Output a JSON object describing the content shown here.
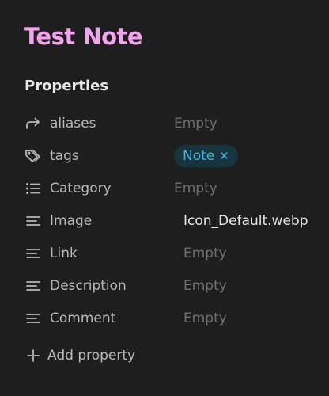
{
  "note": {
    "title": "Test Note"
  },
  "properties": {
    "heading": "Properties",
    "items": [
      {
        "icon": "forward-arrow-icon",
        "key": "aliases",
        "value": "Empty",
        "empty": true
      },
      {
        "icon": "tags-icon",
        "key": "tags",
        "tag": "Note",
        "remove_glyph": "✕"
      },
      {
        "icon": "list-icon",
        "key": "Category",
        "value": "Empty",
        "empty": true
      },
      {
        "icon": "text-lines-icon",
        "key": "Image",
        "value": "Icon_Default.webp",
        "empty": false
      },
      {
        "icon": "text-lines-icon",
        "key": "Link",
        "value": "Empty",
        "empty": true
      },
      {
        "icon": "text-lines-icon",
        "key": "Description",
        "value": "Empty",
        "empty": true
      },
      {
        "icon": "text-lines-icon",
        "key": "Comment",
        "value": "Empty",
        "empty": true
      }
    ],
    "add_label": "Add property"
  },
  "colors": {
    "background": "#1e1e1e",
    "title": "#f5a3f0",
    "tag_text": "#3fb7e0",
    "tag_bg": "#17343f"
  }
}
